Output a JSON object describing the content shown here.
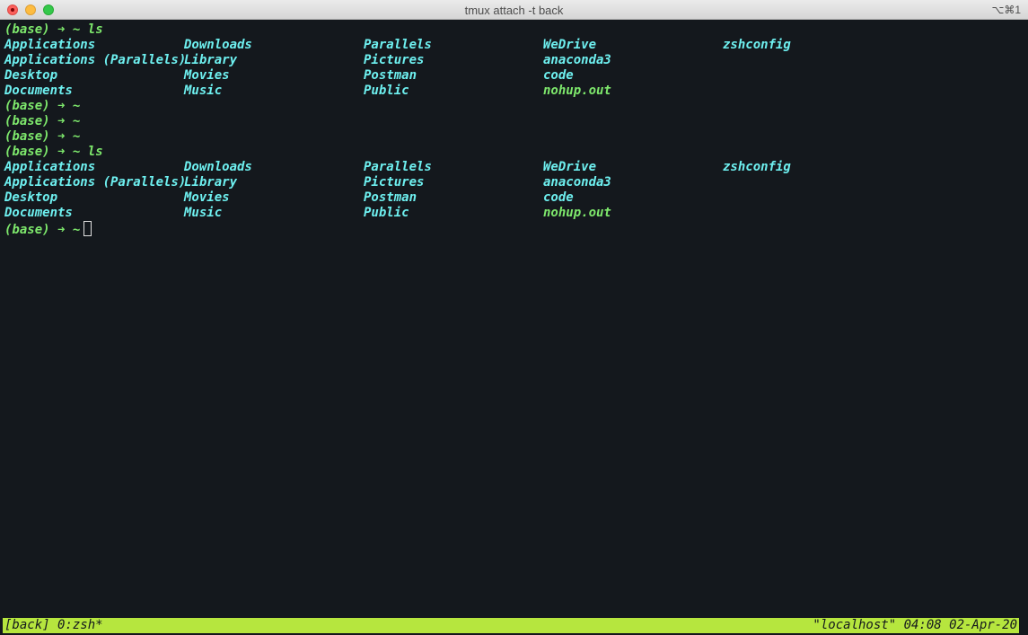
{
  "window": {
    "title": "tmux attach -t back",
    "shortcut": "⌥⌘1"
  },
  "prompt": {
    "env": "(base)",
    "arrow": "➜",
    "dir": "~"
  },
  "command_ls": "ls",
  "listing": [
    [
      "Applications",
      "Downloads",
      "Parallels",
      "WeDrive",
      "zshconfig"
    ],
    [
      "Applications (Parallels)",
      "Library",
      "Pictures",
      "anaconda3",
      ""
    ],
    [
      "Desktop",
      "Movies",
      "Postman",
      "code",
      ""
    ],
    [
      "Documents",
      "Music",
      "Public",
      "nohup.out",
      ""
    ]
  ],
  "status": {
    "left": "[back] 0:zsh*",
    "right": "\"localhost\" 04:08 02-Apr-20"
  },
  "colors": {
    "background": "#14181d",
    "directory": "#6ef0f0",
    "prompt": "#7ee86c",
    "status_bar": "#b6e63e"
  }
}
